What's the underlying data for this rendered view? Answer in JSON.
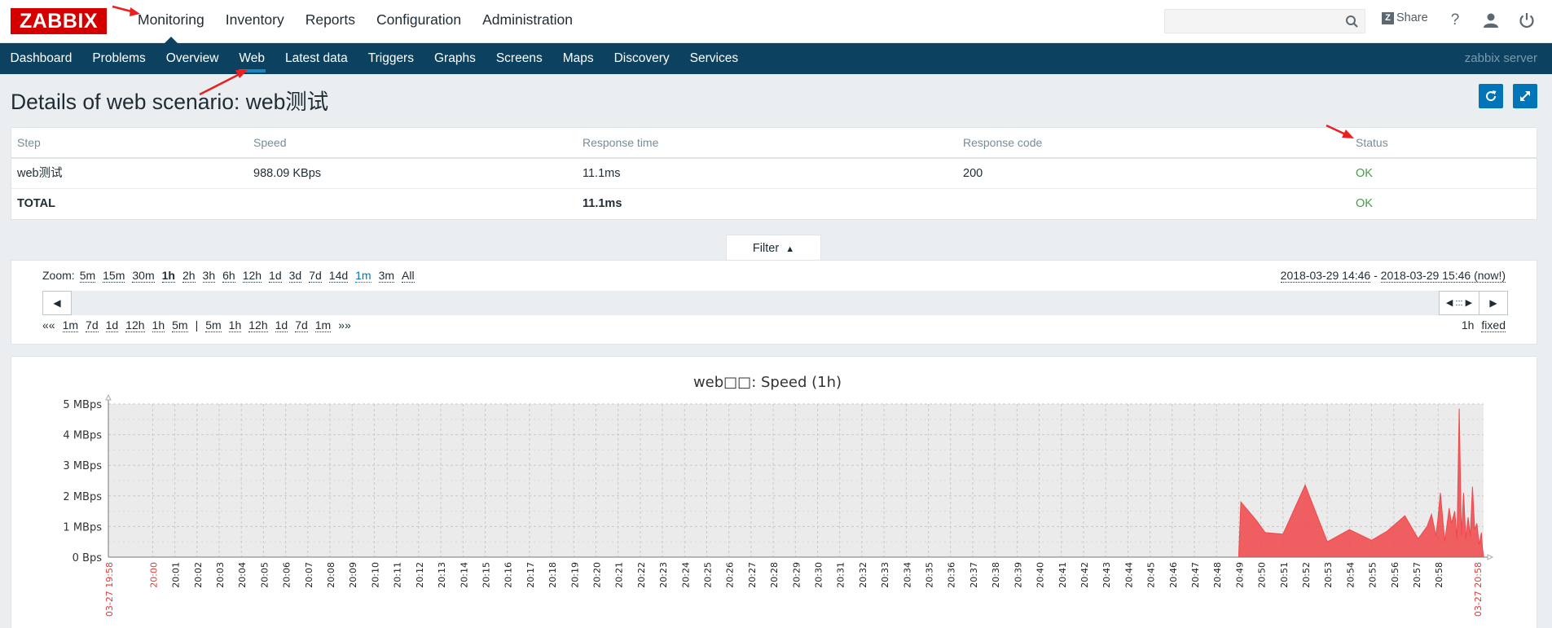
{
  "header": {
    "logo": "ZABBIX",
    "nav": [
      {
        "label": "Monitoring",
        "active": true
      },
      {
        "label": "Inventory",
        "active": false
      },
      {
        "label": "Reports",
        "active": false
      },
      {
        "label": "Configuration",
        "active": false
      },
      {
        "label": "Administration",
        "active": false
      }
    ],
    "search_placeholder": "",
    "share_icon_letter": "Z",
    "share_label": "Share",
    "help_label": "?"
  },
  "subnav": {
    "items": [
      {
        "label": "Dashboard",
        "active": false
      },
      {
        "label": "Problems",
        "active": false
      },
      {
        "label": "Overview",
        "active": false
      },
      {
        "label": "Web",
        "active": true
      },
      {
        "label": "Latest data",
        "active": false
      },
      {
        "label": "Triggers",
        "active": false
      },
      {
        "label": "Graphs",
        "active": false
      },
      {
        "label": "Screens",
        "active": false
      },
      {
        "label": "Maps",
        "active": false
      },
      {
        "label": "Discovery",
        "active": false
      },
      {
        "label": "Services",
        "active": false
      }
    ],
    "server_name": "zabbix server"
  },
  "page": {
    "title": "Details of web scenario: web测试"
  },
  "table": {
    "columns": [
      "Step",
      "Speed",
      "Response time",
      "Response code",
      "Status"
    ],
    "rows": [
      {
        "step": "web测试",
        "speed": "988.09 KBps",
        "response_time": "11.1ms",
        "response_code": "200",
        "status": "OK"
      }
    ],
    "total": {
      "label": "TOTAL",
      "response_time": "11.1ms",
      "status": "OK"
    }
  },
  "filter": {
    "tab_label": "Filter",
    "tab_arrow": "▲",
    "zoom_label": "Zoom:",
    "zoom_options": [
      "5m",
      "15m",
      "30m",
      "1h",
      "2h",
      "3h",
      "6h",
      "12h",
      "1d",
      "3d",
      "7d",
      "14d",
      "1m",
      "3m",
      "All"
    ],
    "zoom_selected": "1h",
    "zoom_highlight": "1m",
    "period_from": "2018-03-29 14:46",
    "period_sep": " - ",
    "period_to": "2018-03-29 15:46 (now!)",
    "back_arrow": "◀",
    "forward_arrow": "▶",
    "handle_glyph": "◀ ::: ▶",
    "nav_back_prefix": "««",
    "nav_back": [
      "1m",
      "7d",
      "1d",
      "12h",
      "1h",
      "5m"
    ],
    "nav_sep": "|",
    "nav_forward": [
      "5m",
      "1h",
      "12h",
      "1d",
      "7d",
      "1m"
    ],
    "nav_forward_suffix": "»»",
    "period_length": "1h",
    "fixed_label": "fixed"
  },
  "chart_data": {
    "type": "area",
    "title": "web□□: Speed (1h)",
    "ylabel": "",
    "xlabel": "",
    "y_ticks": [
      "0 Bps",
      "1 MBps",
      "2 MBps",
      "3 MBps",
      "4 MBps",
      "5 MBps"
    ],
    "ylim": [
      0,
      5
    ],
    "x_ticks": [
      "20:01",
      "20:02",
      "20:03",
      "20:04",
      "20:05",
      "20:06",
      "20:07",
      "20:08",
      "20:09",
      "20:10",
      "20:11",
      "20:12",
      "20:13",
      "20:14",
      "20:15",
      "20:16",
      "20:17",
      "20:18",
      "20:19",
      "20:20",
      "20:21",
      "20:22",
      "20:23",
      "20:24",
      "20:25",
      "20:26",
      "20:27",
      "20:28",
      "20:29",
      "20:30",
      "20:31",
      "20:32",
      "20:33",
      "20:34",
      "20:35",
      "20:36",
      "20:37",
      "20:38",
      "20:39",
      "20:40",
      "20:41",
      "20:42",
      "20:43",
      "20:44",
      "20:45",
      "20:46",
      "20:47",
      "20:48",
      "20:49",
      "20:50",
      "20:51",
      "20:52",
      "20:53",
      "20:54",
      "20:55",
      "20:56",
      "20:57",
      "20:58"
    ],
    "x_start_label": "03-27 19:58",
    "x_hour_label": "20:00",
    "x_end_label": "03-27 20:58",
    "xlim_minutes": [
      0,
      60
    ],
    "series": [
      {
        "color": "#f0474a",
        "x_minutes": [
          51,
          51.1,
          51.8,
          52.2,
          53,
          54,
          55,
          56,
          57,
          57.7,
          58.5,
          59.1,
          59.5,
          59.7,
          59.9,
          60,
          60.1,
          60.3,
          60.5,
          60.6,
          60.75,
          60.85,
          60.95,
          61.05,
          61.15,
          61.25,
          61.35,
          61.45,
          61.55,
          61.65,
          61.75,
          61.85,
          61.95,
          62,
          62.05
        ],
        "values": [
          0,
          1.8,
          1.2,
          0.8,
          0.75,
          2.35,
          0.5,
          0.9,
          0.55,
          0.85,
          1.35,
          0.6,
          1.0,
          1.4,
          0.7,
          1.3,
          2.1,
          0.5,
          1.6,
          1.1,
          1.5,
          0.6,
          4.85,
          0.7,
          2.1,
          0.6,
          1.3,
          0.7,
          2.3,
          0.9,
          1.1,
          0.4,
          0.8,
          0.3,
          0
        ]
      }
    ],
    "legend": "none",
    "grid": true
  },
  "colors": {
    "logo": "#d40000",
    "nav_bar": "#0c4160",
    "accent": "#0275b8",
    "ok": "#429e47",
    "series": "#f0474a",
    "annotation": "#e82020"
  }
}
